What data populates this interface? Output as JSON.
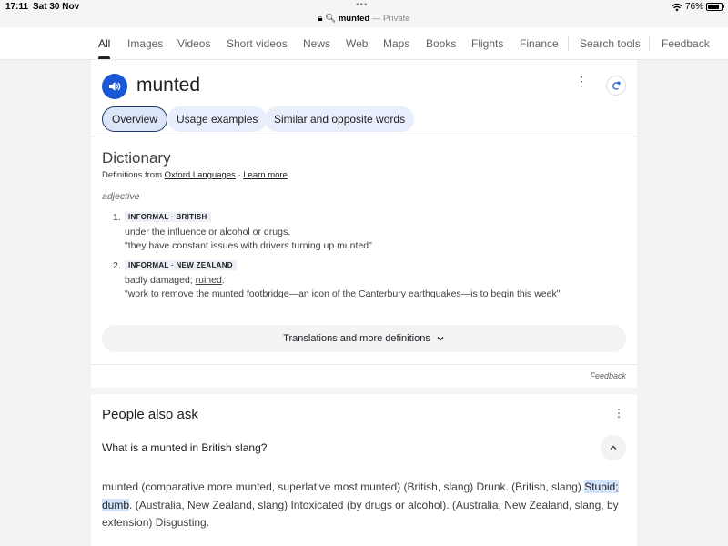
{
  "status": {
    "time": "17:11",
    "date": "Sat 30 Nov",
    "battery": "76%",
    "url_text": "munted",
    "url_suffix": "— Private"
  },
  "tabs": [
    {
      "label": "All",
      "active": true
    },
    {
      "label": "Images"
    },
    {
      "label": "Videos"
    },
    {
      "label": "Short videos"
    },
    {
      "label": "News"
    },
    {
      "label": "Web"
    },
    {
      "label": "Maps"
    },
    {
      "label": "Books"
    },
    {
      "label": "Flights"
    },
    {
      "label": "Finance"
    },
    {
      "label": "Search tools"
    },
    {
      "label": "Feedback"
    }
  ],
  "dictionary": {
    "headword": "munted",
    "chips": [
      "Overview",
      "Usage examples",
      "Similar and opposite words"
    ],
    "title": "Dictionary",
    "source_prefix": "Definitions from",
    "source_link": "Oxford Languages",
    "source_sep": "·",
    "learn_more": "Learn more",
    "pos": "adjective",
    "senses": [
      {
        "num": "1.",
        "label": "INFORMAL · BRITISH",
        "definition": "under the influence or alcohol or drugs.",
        "example": "\"they have constant issues with drivers turning up munted\""
      },
      {
        "num": "2.",
        "label": "INFORMAL · NEW ZEALAND",
        "definition_before": "badly damaged; ",
        "definition_link": "ruined",
        "definition_after": ".",
        "example": "\"work to remove the munted footbridge—an icon of the Canterbury earthquakes—is to begin this week\""
      }
    ],
    "more_button": "Translations and more definitions",
    "feedback": "Feedback"
  },
  "people_also_ask": {
    "title": "People also ask",
    "question": "What is a munted in British slang?",
    "answer_before": "munted (comparative more munted, superlative most munted) (British, slang) Drunk. (British, slang) ",
    "answer_highlight": "Stupid; dumb",
    "answer_after": ". (Australia, New Zealand, slang) Intoxicated (by drugs or alcohol). (Australia, New Zealand, slang, by extension) Disgusting."
  },
  "colors": {
    "accent_blue": "#1a57d6",
    "chip_bg": "#e8eefc",
    "highlight": "#d2e3fc"
  }
}
